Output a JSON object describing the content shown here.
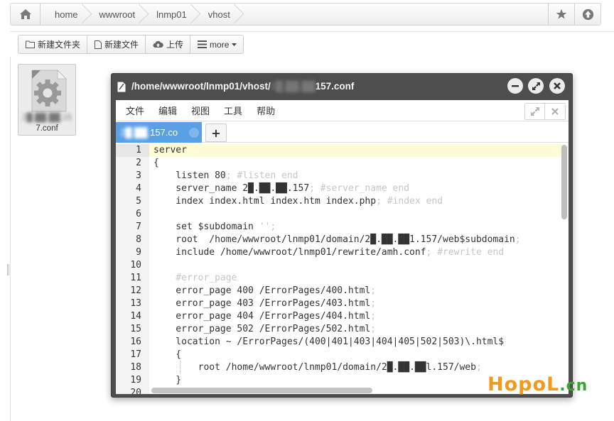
{
  "breadcrumb": [
    "home",
    "wwwroot",
    "lnmp01",
    "vhost"
  ],
  "icons": {
    "home": "home-icon",
    "star": "star-icon",
    "upload": "arrow-up-circle-icon"
  },
  "toolbar": {
    "new_folder": "新建文件夹",
    "new_file": "新建文件",
    "upload": "上传",
    "more": "more"
  },
  "file": {
    "name_line1_hidden": "2█.██.██.15",
    "name_line2": "7.conf"
  },
  "editor": {
    "title_visible_start": "/home/wwwroot/lnmp01/vhost/",
    "title_hidden": "2█.██.██",
    "title_visible_end": "157.conf",
    "menu": [
      "文件",
      "编辑",
      "视图",
      "工具",
      "帮助"
    ],
    "tab_hidden": "2█.██.",
    "tab_visible": "157.co",
    "tab_add": "+"
  },
  "code_lines": [
    {
      "n": "1",
      "code": "server",
      "comment": ""
    },
    {
      "n": "2",
      "code": "{",
      "comment": ""
    },
    {
      "n": "3",
      "code": "    listen 80",
      "comment": "; #listen end"
    },
    {
      "n": "4",
      "code": "    server_name 2█.██.██.157",
      "comment": "; #server_name end"
    },
    {
      "n": "5",
      "code": "    index index.html index.htm index.php",
      "comment": "; #index end"
    },
    {
      "n": "6",
      "code": "",
      "comment": ""
    },
    {
      "n": "7",
      "code": "    set $subdomain ",
      "comment": "'';"
    },
    {
      "n": "8",
      "code": "    root  /home/wwwroot/lnmp01/domain/2█.██.██1.157/web$subdomain",
      "comment": ";"
    },
    {
      "n": "9",
      "code": "    include /home/wwwroot/lnmp01/rewrite/amh.conf",
      "comment": "; #rewrite end"
    },
    {
      "n": "10",
      "code": "",
      "comment": ""
    },
    {
      "n": "11",
      "code": "",
      "comment": "    #error_page"
    },
    {
      "n": "12",
      "code": "    error_page 400 /ErrorPages/400.html",
      "comment": ";"
    },
    {
      "n": "13",
      "code": "    error_page 403 /ErrorPages/403.html",
      "comment": ";"
    },
    {
      "n": "14",
      "code": "    error_page 404 /ErrorPages/404.html",
      "comment": ";"
    },
    {
      "n": "15",
      "code": "    error_page 502 /ErrorPages/502.html",
      "comment": ";"
    },
    {
      "n": "16",
      "code": "    location ~ /ErrorPages/(400|401|403|404|405|502|503)\\.html$",
      "comment": ""
    },
    {
      "n": "17",
      "code": "    {",
      "comment": ""
    },
    {
      "n": "18",
      "code": "        root /home/wwwroot/lnmp01/domain/2█.██.██l.157/web",
      "comment": ";"
    },
    {
      "n": "19",
      "code": "    }",
      "comment": ""
    },
    {
      "n": "20",
      "code": "",
      "comment": ""
    }
  ],
  "watermark": {
    "main": "HopoL",
    "tld": ".cn"
  },
  "colors": {
    "tab_active": "#5aa0e6",
    "active_line": "#fffbd6",
    "watermark_orange": "#f39a1e",
    "watermark_green": "#3aa334"
  }
}
